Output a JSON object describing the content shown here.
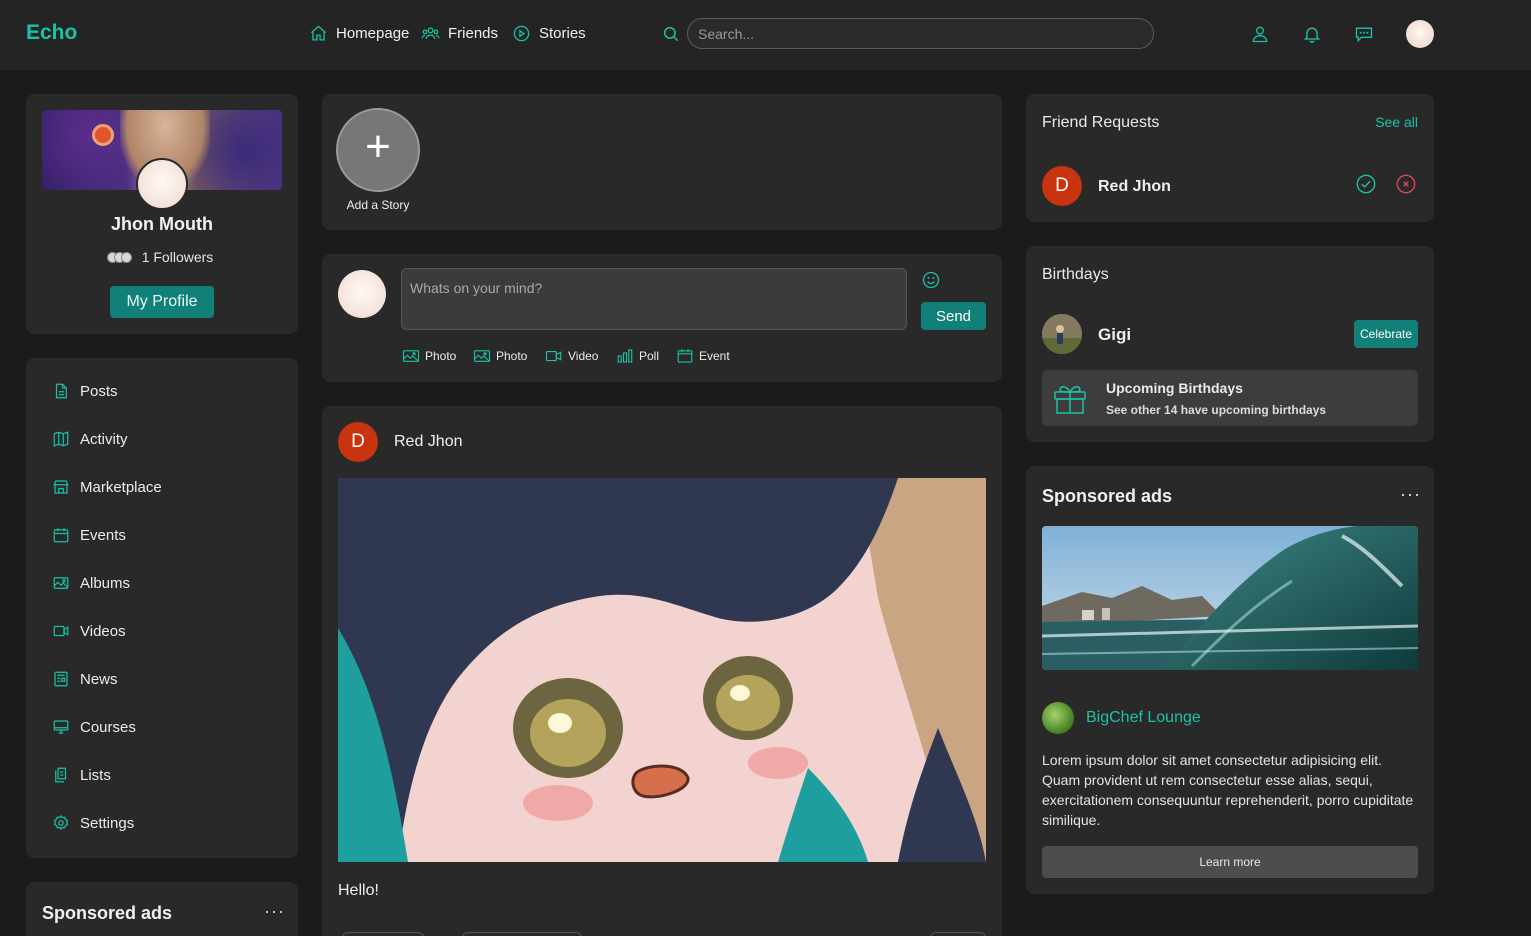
{
  "app": {
    "logo": "Echo"
  },
  "nav": {
    "homepage": "Homepage",
    "friends": "Friends",
    "stories": "Stories"
  },
  "search": {
    "placeholder": "Search..."
  },
  "profile": {
    "name": "Jhon Mouth",
    "followers": "1 Followers",
    "button": "My Profile"
  },
  "menu": {
    "items": [
      {
        "label": "Posts",
        "icon": "document-icon"
      },
      {
        "label": "Activity",
        "icon": "map-icon"
      },
      {
        "label": "Marketplace",
        "icon": "store-icon"
      },
      {
        "label": "Events",
        "icon": "calendar-icon"
      },
      {
        "label": "Albums",
        "icon": "image-icon"
      },
      {
        "label": "Videos",
        "icon": "video-icon"
      },
      {
        "label": "News",
        "icon": "newspaper-icon"
      },
      {
        "label": "Courses",
        "icon": "monitor-icon"
      },
      {
        "label": "Lists",
        "icon": "list-icon"
      },
      {
        "label": "Settings",
        "icon": "gear-icon"
      }
    ]
  },
  "left_ads": {
    "title": "Sponsored ads",
    "more": "···"
  },
  "stories": {
    "add_label": "Add a Story"
  },
  "composer": {
    "placeholder": "Whats on your mind?",
    "send": "Send",
    "attachments": [
      "Photo",
      "Photo",
      "Video",
      "Poll",
      "Event"
    ]
  },
  "post": {
    "avatar_letter": "D",
    "author": "Red Jhon",
    "text": "Hello!"
  },
  "friend_requests": {
    "title": "Friend Requests",
    "see_all": "See all",
    "items": [
      {
        "letter": "D",
        "name": "Red Jhon"
      }
    ]
  },
  "birthdays": {
    "title": "Birthdays",
    "name": "Gigi",
    "celebrate": "Celebrate",
    "upcoming_title": "Upcoming Birthdays",
    "upcoming_sub": "See other 14 have upcoming birthdays"
  },
  "right_ads": {
    "title": "Sponsored ads",
    "more": "···",
    "brand": "BigChef Lounge",
    "body": "Lorem ipsum dolor sit amet consectetur adipisicing elit. Quam provident ut rem consectetur esse alias, sequi, exercitationem consequuntur reprehenderit, porro cupiditate similique.",
    "button": "Learn more"
  },
  "colors": {
    "accent": "#19c3a8",
    "button": "#118078",
    "background": "#1b1b1b",
    "card": "#292929",
    "avatar_red": "#c9330f"
  }
}
